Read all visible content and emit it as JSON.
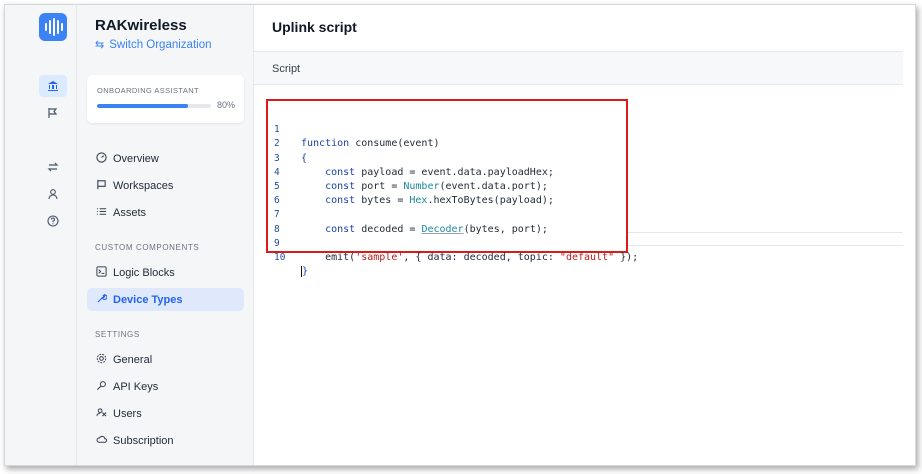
{
  "rail": {
    "icons": [
      "bank-icon",
      "flag-icon",
      "swap-icon",
      "user-icon",
      "help-icon"
    ]
  },
  "sidebar": {
    "org_name": "RAKwireless",
    "switch_org": "Switch Organization",
    "onboarding": {
      "label": "ONBOARDING ASSISTANT",
      "percent_text": "80%",
      "progress": 80
    },
    "main_items": [
      {
        "label": "Overview",
        "icon": "gauge-icon"
      },
      {
        "label": "Workspaces",
        "icon": "workspace-icon"
      },
      {
        "label": "Assets",
        "icon": "list-icon"
      }
    ],
    "custom_label": "CUSTOM COMPONENTS",
    "custom_items": [
      {
        "label": "Logic Blocks",
        "icon": "terminal-icon"
      },
      {
        "label": "Device Types",
        "icon": "wrench-icon",
        "active": true
      }
    ],
    "settings_label": "SETTINGS",
    "settings_items": [
      {
        "label": "General",
        "icon": "gear-icon"
      },
      {
        "label": "API Keys",
        "icon": "key-icon"
      },
      {
        "label": "Users",
        "icon": "users-icon"
      },
      {
        "label": "Subscription",
        "icon": "cloud-icon"
      }
    ]
  },
  "main": {
    "title": "Uplink script",
    "section": "Script",
    "line_numbers": [
      "1",
      "2",
      "3",
      "4",
      "5",
      "6",
      "7",
      "8",
      "9",
      "10"
    ],
    "code": {
      "l1_kw": "function",
      "l1_rest": " consume(event)",
      "l2": "{",
      "l3_kw": "const",
      "l3_rest": " payload = event.data.payloadHex;",
      "l4_kw": "const",
      "l4_a": " port = ",
      "l4_fn": "Number",
      "l4_b": "(event.data.port);",
      "l5_kw": "const",
      "l5_a": " bytes = ",
      "l5_fn": "Hex",
      "l5_b": ".hexToBytes(payload);",
      "l7_kw": "const",
      "l7_a": " decoded = ",
      "l7_fn": "Decoder",
      "l7_b": "(bytes, port);",
      "l9_a": "emit(",
      "l9_s1": "'sample'",
      "l9_b": ", { data: decoded, topic: ",
      "l9_s2": "\"default\"",
      "l9_c": " });",
      "l10": "}"
    }
  }
}
